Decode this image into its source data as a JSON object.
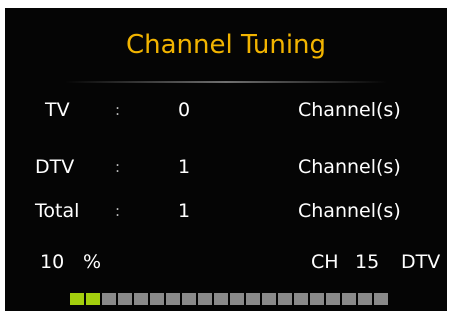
{
  "title": "Channel Tuning",
  "rows": [
    {
      "label": "TV",
      "colon": ":",
      "value": "0",
      "unit": "Channel(s)"
    },
    {
      "label": "DTV",
      "colon": ":",
      "value": "1",
      "unit": "Channel(s)"
    },
    {
      "label": "Total",
      "colon": ":",
      "value": "1",
      "unit": "Channel(s)"
    }
  ],
  "progress": {
    "percent_value": "10",
    "percent_sign": "%",
    "filled_segments": 2,
    "total_segments": 20
  },
  "channel": {
    "label": "CH",
    "number": "15",
    "type": "DTV"
  },
  "colors": {
    "title": "#f2b400",
    "background": "#050505",
    "progress_on": "#a4cf0e",
    "progress_off": "#8a8a8a"
  }
}
